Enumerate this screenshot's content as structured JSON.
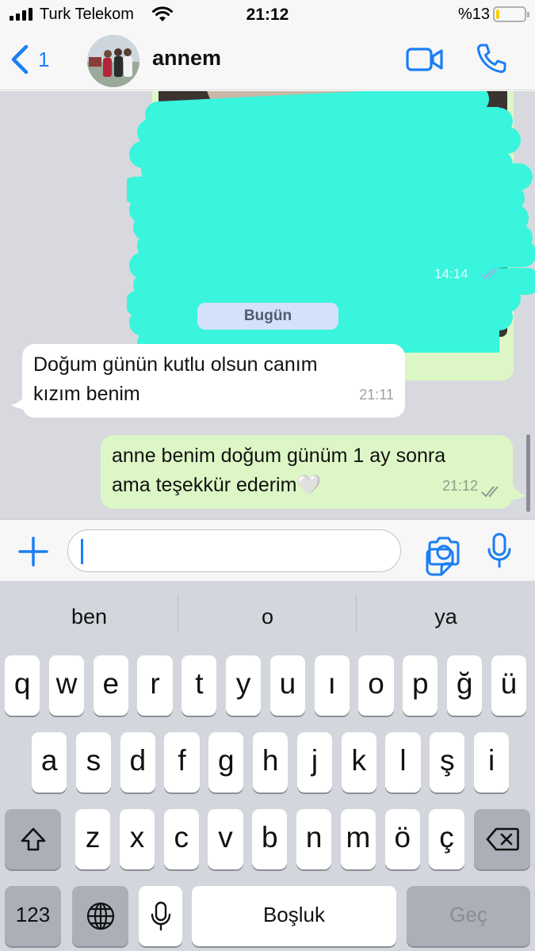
{
  "status_bar": {
    "carrier": "Turk Telekom",
    "time": "21:12",
    "battery_text": "%13",
    "battery_level": 0.13
  },
  "header": {
    "back_count": "1",
    "contact_name": "annem"
  },
  "chat": {
    "image_message": {
      "time": "14:14"
    },
    "date_divider": "Bugün",
    "incoming": {
      "line1": "Doğum günün kutlu olsun canım",
      "line2": "kızım benim",
      "time": "21:11"
    },
    "outgoing": {
      "line1": "anne benim doğum günüm 1 ay sonra",
      "line2": "ama teşekkür ederim🤍",
      "time": "21:12"
    }
  },
  "input": {
    "placeholder": ""
  },
  "keyboard": {
    "suggestions": [
      "ben",
      "o",
      "ya"
    ],
    "row1": [
      "q",
      "w",
      "e",
      "r",
      "t",
      "y",
      "u",
      "ı",
      "o",
      "p",
      "ğ",
      "ü"
    ],
    "row2": [
      "a",
      "s",
      "d",
      "f",
      "g",
      "h",
      "j",
      "k",
      "l",
      "ş",
      "i"
    ],
    "row3": [
      "z",
      "x",
      "c",
      "v",
      "b",
      "n",
      "m",
      "ö",
      "ç"
    ],
    "numbers_label": "123",
    "space_label": "Boşluk",
    "return_label": "Geç"
  }
}
